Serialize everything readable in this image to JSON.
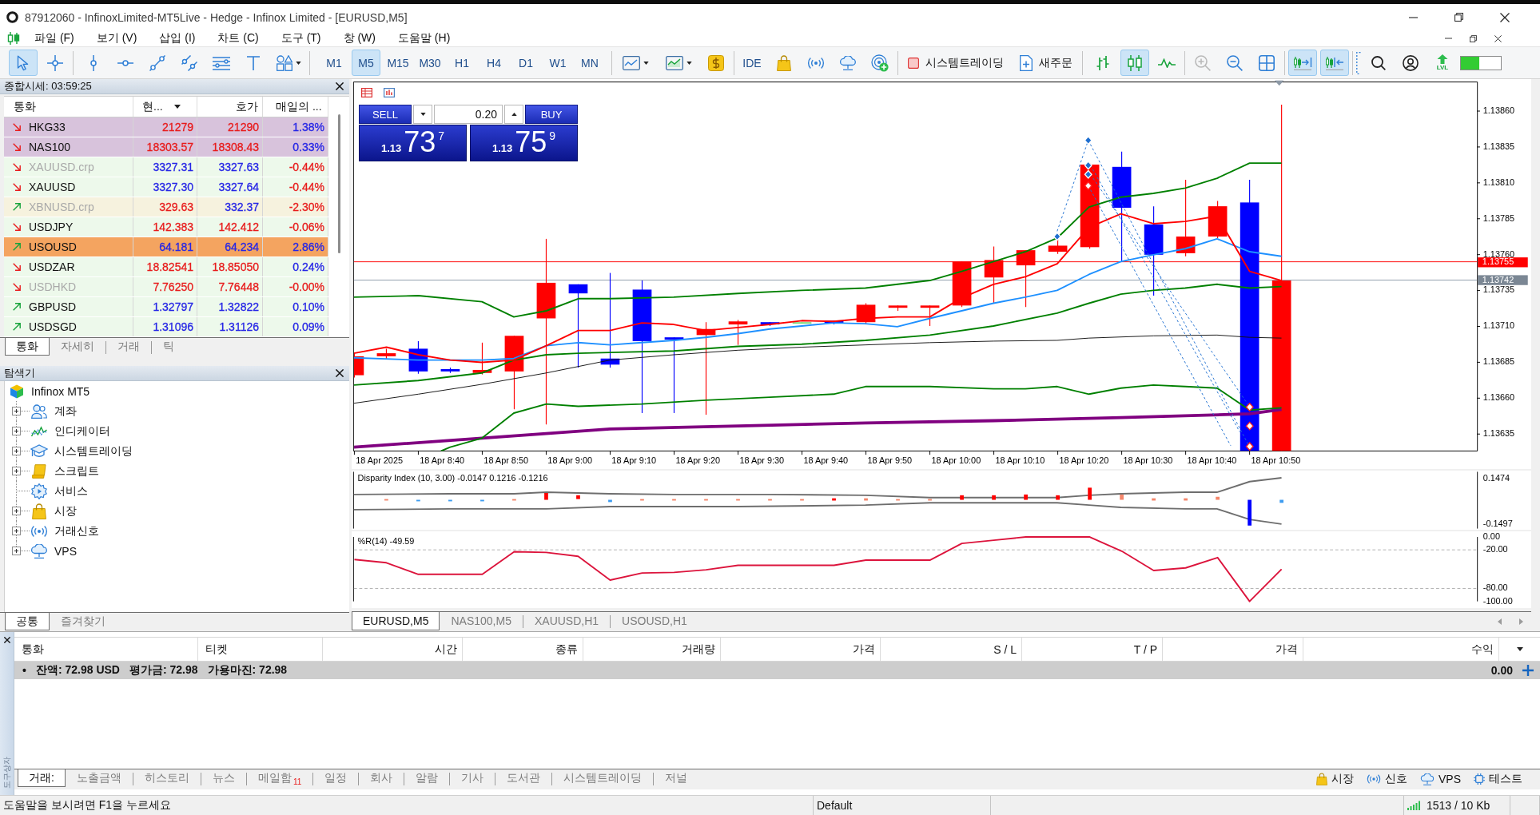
{
  "window": {
    "title": "87912060 - InfinoxLimited-MT5Live - Hedge - Infinox Limited - [EURUSD,M5]"
  },
  "menu": [
    "파일 (F)",
    "보기 (V)",
    "삽입 (I)",
    "차트 (C)",
    "도구 (T)",
    "창 (W)",
    "도움말 (H)"
  ],
  "toolbar": {
    "drawing_tools": [
      {
        "selected": true
      },
      {
        "selected": false
      },
      {
        "selected": false
      },
      {
        "selected": false
      },
      {
        "selected": false
      },
      {
        "selected": false
      },
      {
        "selected": false
      },
      {
        "selected": false
      },
      {
        "selected": false
      }
    ],
    "timeframes": [
      {
        "label": "M1",
        "selected": false
      },
      {
        "label": "M5",
        "selected": true
      },
      {
        "label": "M15",
        "selected": false
      },
      {
        "label": "M30",
        "selected": false
      },
      {
        "label": "H1",
        "selected": false
      },
      {
        "label": "H4",
        "selected": false
      },
      {
        "label": "D1",
        "selected": false
      },
      {
        "label": "W1",
        "selected": false
      },
      {
        "label": "MN",
        "selected": false
      }
    ],
    "ide": "IDE",
    "system_trading": "시스템트레이딩",
    "new_order": "새주문",
    "chart_types": [
      {
        "selected": false
      },
      {
        "selected": true
      },
      {
        "selected": false
      }
    ],
    "zoom_in": {
      "disabled": true
    },
    "zoom_out": {
      "disabled": false
    },
    "auto_scroll": {
      "selected": true
    },
    "chart_shift": {
      "selected": true
    },
    "level_badge": "LVL",
    "progress": {
      "level": 0.45
    }
  },
  "market_watch": {
    "title": "종합시세: 03:59:25",
    "columns": [
      {
        "label": "통화",
        "sorted": false
      },
      {
        "label": "현...",
        "sorted": true
      },
      {
        "label": "호가",
        "sorted": false
      },
      {
        "label": "매일의 ...",
        "sorted": false
      }
    ],
    "rows": [
      {
        "symbol": "HKG33",
        "rising": false,
        "disabled": false,
        "color": "#d8c3dc",
        "bid": {
          "text": "21279",
          "color": "#e81c1c"
        },
        "ask": {
          "text": "21290",
          "color": "#e81c1c"
        },
        "change": {
          "text": "1.38%",
          "color": "#2626e6"
        }
      },
      {
        "symbol": "NAS100",
        "rising": false,
        "disabled": false,
        "color": "#d8c3dc",
        "bid": {
          "text": "18303.57",
          "color": "#e81c1c"
        },
        "ask": {
          "text": "18308.43",
          "color": "#e81c1c"
        },
        "change": {
          "text": "0.33%",
          "color": "#2626e6"
        }
      },
      {
        "symbol": "XAUUSD.crp",
        "rising": false,
        "disabled": true,
        "color": "#edf9eb",
        "bid": {
          "text": "3327.31",
          "color": "#2626e6"
        },
        "ask": {
          "text": "3327.63",
          "color": "#2626e6"
        },
        "change": {
          "text": "-0.44%",
          "color": "#e81c1c"
        }
      },
      {
        "symbol": "XAUUSD",
        "rising": false,
        "disabled": false,
        "color": "#edf9eb",
        "bid": {
          "text": "3327.30",
          "color": "#2626e6"
        },
        "ask": {
          "text": "3327.64",
          "color": "#2626e6"
        },
        "change": {
          "text": "-0.44%",
          "color": "#e81c1c"
        }
      },
      {
        "symbol": "XBNUSD.crp",
        "rising": true,
        "disabled": true,
        "color": "#f6f2de",
        "bid": {
          "text": "329.63",
          "color": "#e81c1c"
        },
        "ask": {
          "text": "332.37",
          "color": "#2626e6"
        },
        "change": {
          "text": "-2.30%",
          "color": "#e81c1c"
        }
      },
      {
        "symbol": "USDJPY",
        "rising": false,
        "disabled": false,
        "color": "#edf9eb",
        "bid": {
          "text": "142.383",
          "color": "#e81c1c"
        },
        "ask": {
          "text": "142.412",
          "color": "#e81c1c"
        },
        "change": {
          "text": "-0.06%",
          "color": "#e81c1c"
        }
      },
      {
        "symbol": "USOUSD",
        "rising": true,
        "disabled": false,
        "color": "#f4a460",
        "bid": {
          "text": "64.181",
          "color": "#2626e6"
        },
        "ask": {
          "text": "64.234",
          "color": "#2626e6"
        },
        "change": {
          "text": "2.86%",
          "color": "#2626e6"
        }
      },
      {
        "symbol": "USDZAR",
        "rising": false,
        "disabled": false,
        "color": "#edf9eb",
        "bid": {
          "text": "18.82541",
          "color": "#e81c1c"
        },
        "ask": {
          "text": "18.85050",
          "color": "#e81c1c"
        },
        "change": {
          "text": "0.24%",
          "color": "#2626e6"
        }
      },
      {
        "symbol": "USDHKD",
        "rising": false,
        "disabled": true,
        "color": "#edf9eb",
        "bid": {
          "text": "7.76250",
          "color": "#e81c1c"
        },
        "ask": {
          "text": "7.76448",
          "color": "#e81c1c"
        },
        "change": {
          "text": "-0.00%",
          "color": "#e81c1c"
        }
      },
      {
        "symbol": "GBPUSD",
        "rising": true,
        "disabled": false,
        "color": "#edf9eb",
        "bid": {
          "text": "1.32797",
          "color": "#2626e6"
        },
        "ask": {
          "text": "1.32822",
          "color": "#2626e6"
        },
        "change": {
          "text": "0.10%",
          "color": "#2626e6"
        }
      },
      {
        "symbol": "USDSGD",
        "rising": true,
        "disabled": false,
        "color": "#edf9eb",
        "bid": {
          "text": "1.31096",
          "color": "#2626e6"
        },
        "ask": {
          "text": "1.31126",
          "color": "#2626e6"
        },
        "change": {
          "text": "0.09%",
          "color": "#2626e6"
        }
      }
    ],
    "tabs": [
      {
        "label": "통화",
        "selected": true
      },
      {
        "label": "자세히",
        "selected": false
      },
      {
        "label": "거래",
        "selected": false
      },
      {
        "label": "틱",
        "selected": false
      }
    ]
  },
  "navigator": {
    "title": "탐색기",
    "root": {
      "label": "Infinox MT5",
      "children": [
        {
          "label": "계좌",
          "expandable": true
        },
        {
          "label": "인디케이터",
          "expandable": true
        },
        {
          "label": "시스템트레이딩",
          "expandable": true
        },
        {
          "label": "스크립트",
          "expandable": true
        },
        {
          "label": "서비스",
          "expandable": false
        },
        {
          "label": "시장",
          "expandable": true
        },
        {
          "label": "거래신호",
          "expandable": true
        },
        {
          "label": "VPS",
          "expandable": true
        }
      ]
    },
    "tabs": [
      {
        "label": "공통",
        "selected": true
      },
      {
        "label": "즐겨찾기",
        "selected": false
      }
    ]
  },
  "chart": {
    "trade_panel": {
      "sell": "SELL",
      "buy": "BUY",
      "volume": "0.20",
      "bid": {
        "prefix": "1.13",
        "main": "73",
        "suffix": "7"
      },
      "ask": {
        "prefix": "1.13",
        "main": "75",
        "suffix": "9"
      }
    },
    "price_axis": [
      "1.13860",
      "1.13835",
      "1.13810",
      "1.13785",
      "1.13760",
      "1.13735",
      "1.13710",
      "1.13685",
      "1.13660",
      "1.13635"
    ],
    "ask_tag": "1.13755",
    "bid_tag": "1.13742",
    "time_axis": [
      "18 Apr 2025",
      "18 Apr 8:40",
      "18 Apr 8:50",
      "18 Apr 9:00",
      "18 Apr 9:10",
      "18 Apr 9:20",
      "18 Apr 9:30",
      "18 Apr 9:40",
      "18 Apr 9:50",
      "18 Apr 10:00",
      "18 Apr 10:10",
      "18 Apr 10:20",
      "18 Apr 10:30",
      "18 Apr 10:40",
      "18 Apr 10:50"
    ],
    "disparity": {
      "title": "Disparity Index (10, 3.00) -0.0147 0.1216 -0.1216",
      "axis": [
        "0.1474",
        "-0.1497"
      ]
    },
    "williams_r": {
      "chart_data": {
        "type": "line",
        "title": "%R(14) -49.59",
        "ylim": [
          -100,
          0
        ],
        "yticks": [
          {
            "value": 0,
            "label": "0.00"
          },
          {
            "value": -20,
            "label": "-20.00"
          },
          {
            "value": -80,
            "label": "-80.00"
          },
          {
            "value": -100,
            "label": "-100.00"
          }
        ],
        "series": [
          {
            "color": "#dc143c",
            "values": [
              -35,
              -40,
              -58,
              -58,
              -58,
              -23,
              -24,
              -30,
              -67,
              -56,
              -55,
              -51,
              -44,
              -44,
              -44,
              -44,
              -36,
              -36,
              -36,
              -10,
              -5,
              0,
              0,
              0,
              -22,
              -52,
              -48,
              -32,
              -100,
              -50
            ]
          }
        ]
      }
    },
    "tabs": [
      {
        "label": "EURUSD,M5",
        "selected": true
      },
      {
        "label": "NAS100,M5",
        "selected": false
      },
      {
        "label": "XAUUSD,H1",
        "selected": false
      },
      {
        "label": "USOUSD,H1",
        "selected": false
      }
    ]
  },
  "terminal": {
    "side_label": "도구상자",
    "columns": [
      "통화",
      "티켓",
      "시간",
      "종류",
      "거래량",
      "가격",
      "S / L",
      "T / P",
      "가격",
      "수익"
    ],
    "balance": {
      "marker": "•",
      "items": [
        "잔액: 72.98 USD",
        "평가금: 72.98",
        "가용마진: 72.98"
      ],
      "profit": "0.00"
    },
    "tabs": [
      {
        "label": "거래:",
        "selected": true
      },
      {
        "label": "노출금액",
        "selected": false
      },
      {
        "label": "히스토리",
        "selected": false
      },
      {
        "label": "뉴스",
        "selected": false
      },
      {
        "label": "메일함",
        "selected": false,
        "badge": "11"
      },
      {
        "label": "일정",
        "selected": false
      },
      {
        "label": "회사",
        "selected": false
      },
      {
        "label": "알람",
        "selected": false
      },
      {
        "label": "기사",
        "selected": false
      },
      {
        "label": "도서관",
        "selected": false
      },
      {
        "label": "시스템트레이딩",
        "selected": false
      },
      {
        "label": "저널",
        "selected": false
      }
    ],
    "services": [
      "시장",
      "신호",
      "VPS",
      "테스트"
    ]
  },
  "status_bar": {
    "help": "도움말을 보시려면 F1을 누르세요",
    "profile": "Default",
    "traffic": "1513 / 10 Kb"
  }
}
